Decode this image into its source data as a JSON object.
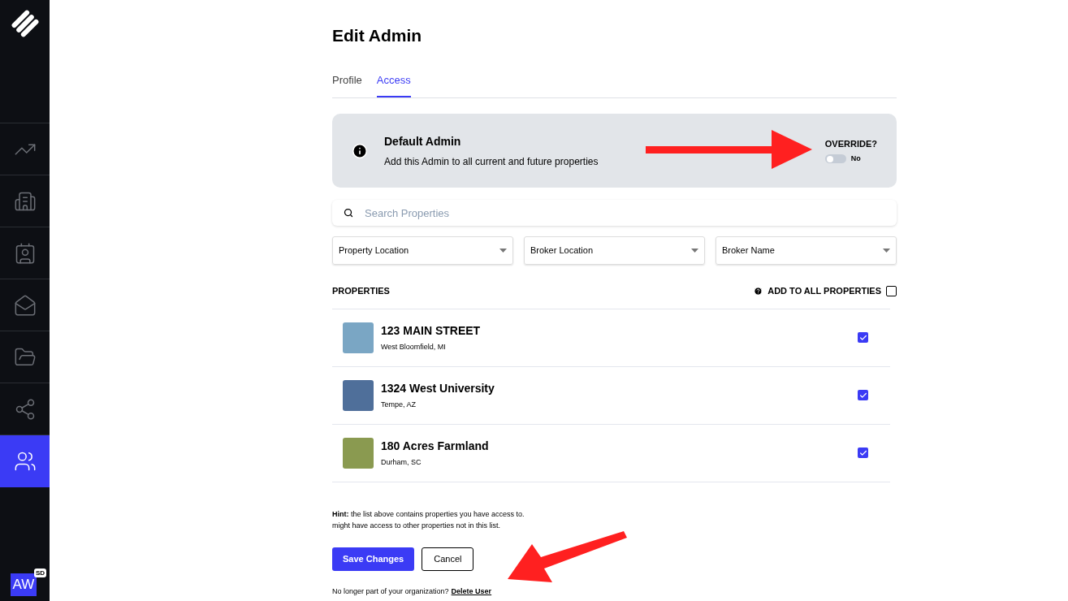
{
  "sidebar": {
    "items": [
      {
        "kind": "chart",
        "selected": false
      },
      {
        "kind": "buildings",
        "selected": false
      },
      {
        "kind": "contact",
        "selected": false
      },
      {
        "kind": "mail",
        "selected": false
      },
      {
        "kind": "folder",
        "selected": false
      },
      {
        "kind": "network",
        "selected": false
      },
      {
        "kind": "users",
        "selected": true
      }
    ],
    "avatar": {
      "initials": "AW",
      "badge": "SD"
    }
  },
  "title": "Edit Admin",
  "tabs": [
    {
      "label": "Profile",
      "selected": false
    },
    {
      "label": "Access",
      "selected": true
    }
  ],
  "default_admin": {
    "title": "Default Admin",
    "description": "Add this Admin to all current and future properties",
    "override_label": "OVERRIDE?",
    "override": {
      "on": false,
      "label": "No"
    }
  },
  "search": {
    "placeholder": "Search Properties"
  },
  "filters": [
    "Property Location",
    "Broker Location",
    "Broker Name"
  ],
  "properties": {
    "heading": "PROPERTIES",
    "add_all": {
      "label": "ADD TO ALL PROPERTIES",
      "checked": false
    },
    "rows": [
      {
        "name": "123 MAIN STREET",
        "location": "West Bloomfield, MI",
        "checked": true
      },
      {
        "name": "1324 West University",
        "location": "Tempe, AZ",
        "checked": true
      },
      {
        "name": "180 Acres Farmland",
        "location": "Durham, SC",
        "checked": true
      }
    ]
  },
  "hint": [
    "**Hint:** the list above contains properties you have access to.",
    "might have access to other properties not in this list."
  ],
  "buttons": {
    "save": "Save Changes",
    "cancel": "Cancel"
  },
  "delete": {
    "text": "No longer part of your organization?",
    "link": "Delete User"
  }
}
